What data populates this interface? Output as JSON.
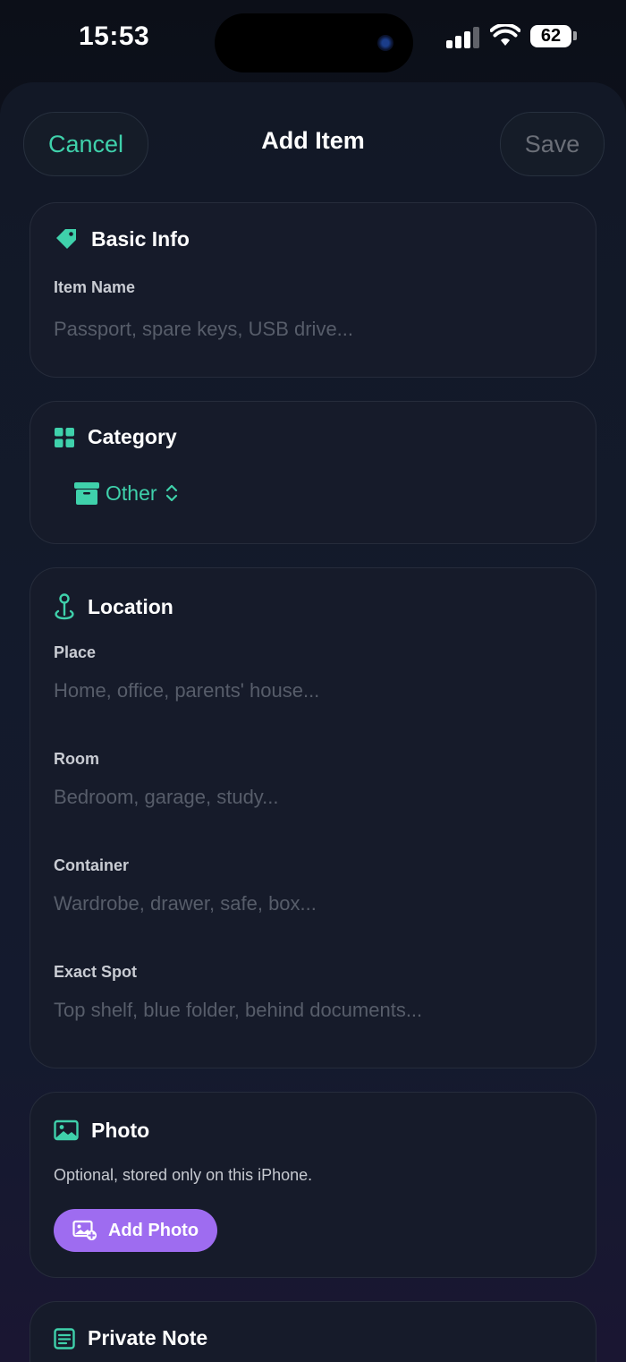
{
  "status": {
    "time": "15:53",
    "battery": "62"
  },
  "nav": {
    "cancel": "Cancel",
    "title": "Add Item",
    "save": "Save"
  },
  "basic": {
    "title": "Basic Info",
    "icon": "tag-icon",
    "name_label": "Item Name",
    "name_placeholder": "Passport, spare keys, USB drive..."
  },
  "category": {
    "title": "Category",
    "icon": "grid-icon",
    "selected": "Other",
    "selected_icon": "archive-box-icon"
  },
  "location": {
    "title": "Location",
    "icon": "map-pin-icon",
    "fields": [
      {
        "label": "Place",
        "placeholder": "Home, office, parents' house..."
      },
      {
        "label": "Room",
        "placeholder": "Bedroom, garage, study..."
      },
      {
        "label": "Container",
        "placeholder": "Wardrobe, drawer, safe, box..."
      },
      {
        "label": "Exact Spot",
        "placeholder": "Top shelf, blue folder, behind documents..."
      }
    ]
  },
  "photo": {
    "title": "Photo",
    "icon": "image-icon",
    "note": "Optional, stored only on this iPhone.",
    "button": "Add Photo"
  },
  "private_note": {
    "title": "Private Note",
    "icon": "note-icon"
  },
  "colors": {
    "accent": "#3fd1ab",
    "purple": "#9e6cf0"
  }
}
